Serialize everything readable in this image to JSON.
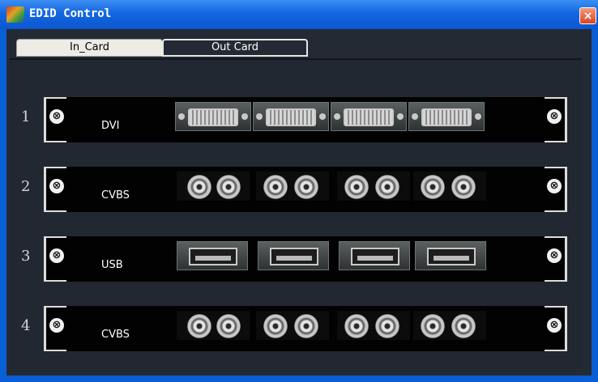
{
  "window": {
    "title": "EDID Control",
    "close_glyph": "×"
  },
  "tabs": [
    {
      "label": "In_Card",
      "active": true
    },
    {
      "label": "Out Card",
      "active": false
    }
  ],
  "slots": [
    {
      "number": "1",
      "label": "DVI",
      "port_type": "dvi-connector-icon",
      "groups": 4
    },
    {
      "number": "2",
      "label": "CVBS",
      "port_type": "bnc-connector-icon",
      "groups": 4
    },
    {
      "number": "3",
      "label": "USB",
      "port_type": "usb-port-icon",
      "groups": 4
    },
    {
      "number": "4",
      "label": "CVBS",
      "port_type": "bnc-connector-icon",
      "groups": 4
    }
  ],
  "icons": {
    "app": "app-icon",
    "close": "close-icon",
    "screw": "screw-icon"
  },
  "colors": {
    "titlebar": "#1466e0",
    "panel": "#222831",
    "card": "#020202"
  }
}
